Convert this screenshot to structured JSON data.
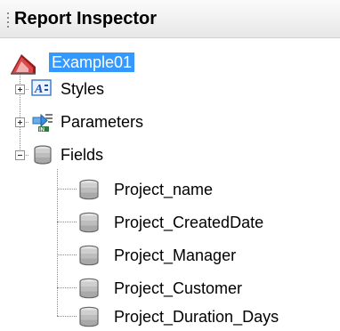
{
  "inspector": {
    "title": "Report Inspector"
  },
  "tree": {
    "root": {
      "label": "Example01",
      "icon": "report-icon",
      "selected": true
    },
    "children": [
      {
        "label": "Styles",
        "icon": "styles-icon",
        "expanded": false
      },
      {
        "label": "Parameters",
        "icon": "parameters-icon",
        "expanded": false
      },
      {
        "label": "Fields",
        "icon": "database-icon",
        "expanded": true,
        "items": [
          {
            "label": "Project_name",
            "icon": "field-database-icon"
          },
          {
            "label": "Project_CreatedDate",
            "icon": "field-database-icon"
          },
          {
            "label": "Project_Manager",
            "icon": "field-database-icon"
          },
          {
            "label": "Project_Customer",
            "icon": "field-database-icon"
          },
          {
            "label": "Project_Duration_Days",
            "icon": "field-database-icon"
          }
        ]
      }
    ]
  },
  "colors": {
    "selection": "#3399ff",
    "titlebar": "#eeeeee"
  }
}
